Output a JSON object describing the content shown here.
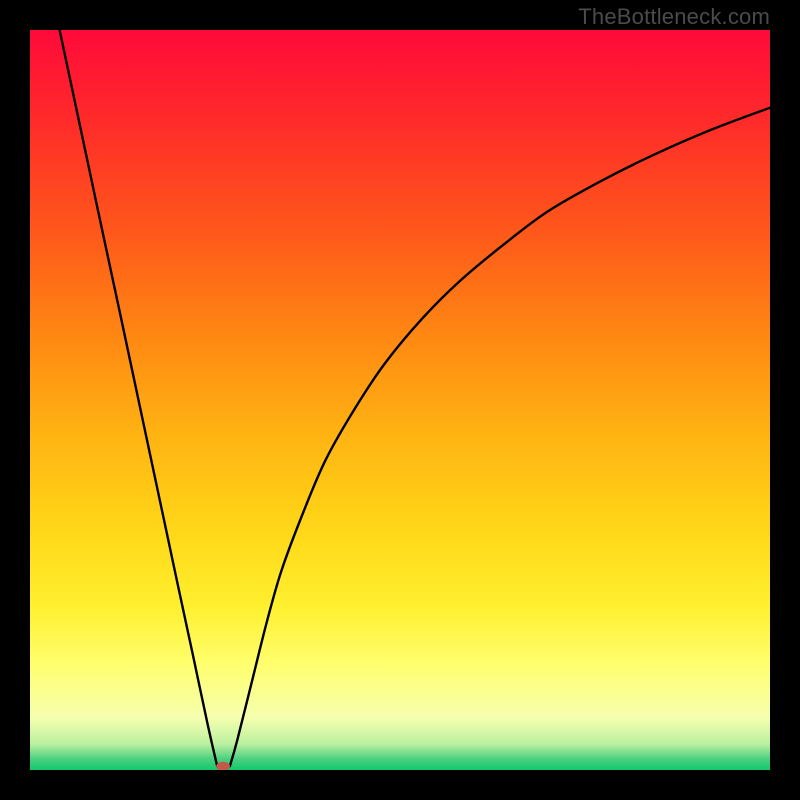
{
  "watermark": "TheBottleneck.com",
  "chart_data": {
    "type": "line",
    "title": "",
    "xlabel": "",
    "ylabel": "",
    "xlim": [
      0,
      100
    ],
    "ylim": [
      0,
      100
    ],
    "grid": false,
    "background_gradient": {
      "stops": [
        {
          "pos": 0.0,
          "color": "#ff0a3a"
        },
        {
          "pos": 0.12,
          "color": "#ff2a2a"
        },
        {
          "pos": 0.28,
          "color": "#ff5a1a"
        },
        {
          "pos": 0.42,
          "color": "#ff8a12"
        },
        {
          "pos": 0.55,
          "color": "#ffb412"
        },
        {
          "pos": 0.68,
          "color": "#ffd818"
        },
        {
          "pos": 0.78,
          "color": "#fff030"
        },
        {
          "pos": 0.86,
          "color": "#ffff70"
        },
        {
          "pos": 0.93,
          "color": "#f5ffb0"
        },
        {
          "pos": 0.965,
          "color": "#baf0a0"
        },
        {
          "pos": 0.985,
          "color": "#4cd080"
        },
        {
          "pos": 1.0,
          "color": "#13c96b"
        }
      ]
    },
    "series": [
      {
        "name": "left-branch",
        "x": [
          4,
          6,
          8,
          10,
          12,
          14,
          16,
          18,
          20,
          22,
          24,
          25.3
        ],
        "y": [
          100,
          90.6,
          81.2,
          71.8,
          62.5,
          53.1,
          43.7,
          34.3,
          24.9,
          15.6,
          6.2,
          0.5
        ]
      },
      {
        "name": "right-branch",
        "x": [
          27,
          28,
          30,
          32,
          34,
          37,
          40,
          44,
          48,
          53,
          58,
          64,
          70,
          77,
          84,
          92,
          100
        ],
        "y": [
          0.5,
          4,
          12,
          20,
          27,
          35,
          42,
          49,
          55,
          61,
          66,
          71,
          75.5,
          79.5,
          83,
          86.5,
          89.5
        ]
      }
    ],
    "marker": {
      "name": "minimum-marker",
      "x": 26.1,
      "y": 0.5,
      "color": "#c25a4a",
      "rx": 7,
      "ry": 4.5
    }
  }
}
